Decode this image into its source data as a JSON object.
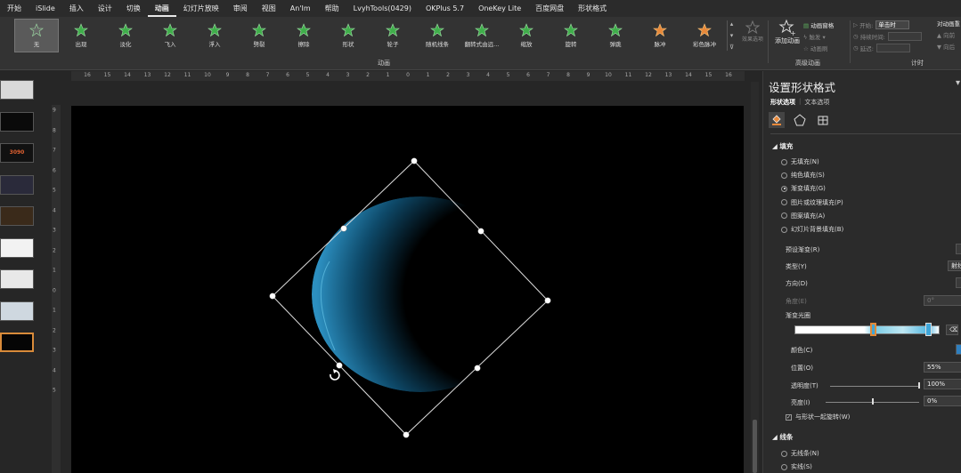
{
  "tabs": [
    "开始",
    "iSlide",
    "插入",
    "设计",
    "切换",
    "动画",
    "幻灯片放映",
    "审阅",
    "视图",
    "An'Im",
    "帮助",
    "LvyhTools(0429)",
    "OKPlus 5.7",
    "OneKey Lite",
    "百度网盘",
    "形状格式"
  ],
  "active_tab": "动画",
  "ribbon": {
    "animations": [
      "无",
      "出现",
      "淡化",
      "飞入",
      "浮入",
      "劈裂",
      "擦除",
      "形状",
      "轮子",
      "随机线条",
      "翻转式由远...",
      "缩放",
      "旋转",
      "弹跳",
      "脉冲",
      "彩色脉冲"
    ],
    "selected_animation": "无",
    "effect_options_label": "效果选项",
    "group_animation": "动画",
    "add_animation_label": "添加动画",
    "advanced": {
      "pane": "动画窗格",
      "trigger": "触发",
      "painter": "动画刷",
      "group_label": "高级动画"
    },
    "timing": {
      "start_label": "开始:",
      "start_value": "单击时",
      "duration_label": "持续时间:",
      "delay_label": "延迟:",
      "group_label": "计时"
    },
    "reorder": {
      "title": "对动画重",
      "forward": "向前",
      "backward": "向后"
    },
    "colors": {
      "star_green": "#3fae4a",
      "star_orange": "#e8893a",
      "star_gray": "#8a8a8a"
    }
  },
  "hruler_labels": [
    "16",
    "15",
    "14",
    "13",
    "12",
    "11",
    "10",
    "9",
    "8",
    "7",
    "6",
    "5",
    "4",
    "3",
    "2",
    "1",
    "0",
    "1",
    "2",
    "3",
    "4",
    "5",
    "6",
    "7",
    "8",
    "9",
    "10",
    "11",
    "12",
    "13",
    "14",
    "15",
    "16"
  ],
  "vruler_labels": [
    "9",
    "8",
    "7",
    "6",
    "5",
    "4",
    "3",
    "2",
    "1",
    "0",
    "1",
    "2",
    "3",
    "4",
    "5"
  ],
  "thumbs": [
    {
      "label": ""
    },
    {
      "label": ""
    },
    {
      "label": "3090"
    },
    {
      "label": ""
    },
    {
      "label": ""
    },
    {
      "label": ""
    },
    {
      "label": ""
    },
    {
      "label": ""
    },
    {
      "label": ""
    }
  ],
  "pane": {
    "title": "设置形状格式",
    "close": "▾",
    "tabs": [
      "形状选项",
      "文本选项"
    ],
    "fill_section": "填充",
    "fill_options": [
      "无填充(N)",
      "纯色填充(S)",
      "渐变填充(G)",
      "图片或纹理填充(P)",
      "图案填充(A)",
      "幻灯片背景填充(B)"
    ],
    "selected_fill": "渐变填充(G)",
    "preset_label": "预设渐变(R)",
    "type_label": "类型(Y)",
    "type_value": "射线",
    "direction_label": "方向(D)",
    "angle_label": "角度(E)",
    "angle_value": "0°",
    "stops_label": "渐变光圈",
    "color_label": "颜色(C)",
    "position_label": "位置(O)",
    "position_value": "55%",
    "transparency_label": "透明度(T)",
    "transparency_value": "100%",
    "brightness_label": "亮度(I)",
    "brightness_value": "0%",
    "rotate_label": "与形状一起旋转(W)",
    "rotate_checked": true,
    "line_section": "线条",
    "line_options": [
      "无线条(N)",
      "实线(S)"
    ]
  }
}
